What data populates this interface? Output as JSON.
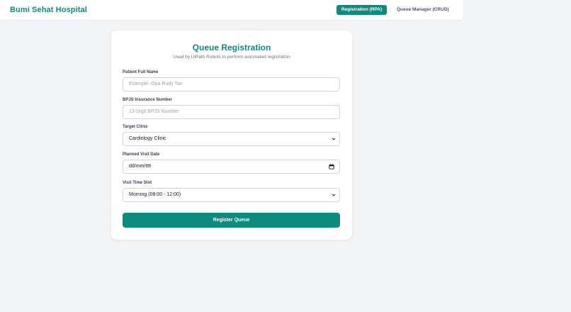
{
  "navbar": {
    "brand": "Bumi Sehat Hospital",
    "links": [
      {
        "label": "Registration (RPA)",
        "active": true
      },
      {
        "label": "Queue Manager (CRUD)",
        "active": false
      }
    ]
  },
  "form": {
    "title": "Queue Registration",
    "subtitle": "Used by UiPath Robots to perform automated registration",
    "fields": {
      "patient_name": {
        "label": "Patient Full Name",
        "placeholder": "Example: Opa Rudy Tan"
      },
      "bpjs_number": {
        "label": "BPJS Insurance Number",
        "placeholder": "13-Digit BPJS Number"
      },
      "clinic": {
        "label": "Target Clinic",
        "value": "Cardiology Clinic"
      },
      "visit_date": {
        "label": "Planned Visit Date",
        "value": "dd/mm/tttt"
      },
      "time_slot": {
        "label": "Visit Time Slot",
        "value": "Morning (08:00 - 12:00)"
      }
    },
    "submit_label": "Register Queue"
  },
  "colors": {
    "accent": "#0f8a7e",
    "background": "#f3f4f6",
    "card": "#ffffff"
  }
}
